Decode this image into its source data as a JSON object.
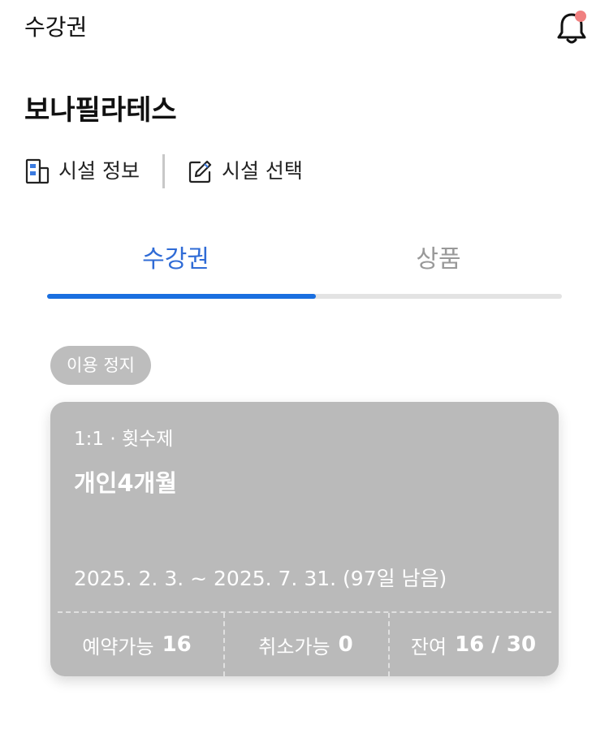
{
  "header": {
    "title": "수강권",
    "notification_icon": "bell-icon",
    "notification_badge_color": "#f08080"
  },
  "facility": {
    "name": "보나필라테스",
    "info_label": "시설 정보",
    "select_label": "시설 선택"
  },
  "tabs": [
    {
      "label": "수강권",
      "active": true
    },
    {
      "label": "상품",
      "active": false
    }
  ],
  "colors": {
    "accent": "#1a6fe0",
    "active_tab_text": "#2f6bd6",
    "inactive_tab_text": "#999999",
    "card_background": "#bababa"
  },
  "tickets": [
    {
      "status": "이용 정지",
      "type": "1:1 · 횟수제",
      "name": "개인4개월",
      "period": "2025. 2. 3. ~ 2025. 7. 31. (97일 남음)",
      "stats": [
        {
          "label": "예약가능",
          "value": "16"
        },
        {
          "label": "취소가능",
          "value": "0"
        },
        {
          "label": "잔여",
          "value": "16 / 30"
        }
      ]
    }
  ]
}
